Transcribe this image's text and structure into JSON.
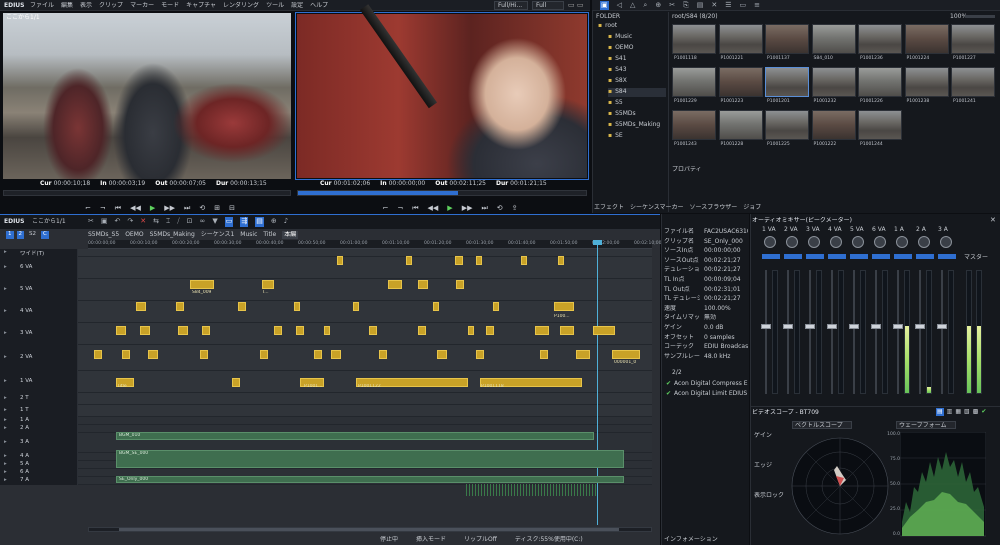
{
  "app": {
    "logo": "EDIUS"
  },
  "menubar": {
    "items": [
      "ファイル",
      "編集",
      "表示",
      "クリップ",
      "マーカー",
      "モード",
      "キャプチャ",
      "レンダリング",
      "ツール",
      "設定",
      "ヘルプ"
    ],
    "quality1": "Full/Hi...",
    "quality2": "Full"
  },
  "player": {
    "title": "ここから1/1",
    "cur": "00:00:10;18",
    "in": "00:00:03;19",
    "out": "00:00:07;05",
    "dur": "00:00:13;15"
  },
  "recorder": {
    "cur": "00:01:02;06",
    "in": "00:00:00;00",
    "out": "00:02:11;25",
    "dur": "00:01:21;15"
  },
  "folder": {
    "header": "FOLDER",
    "items": [
      "root",
      "Music",
      "OEMO",
      "S41",
      "S43",
      "S8X",
      "S84",
      "S5",
      "S5MDs",
      "S5MDs_Making",
      "SE"
    ]
  },
  "bin": {
    "path": "root/S84 (8/20)",
    "clips": [
      "P1001118",
      "P1001221",
      "P1001137",
      "S84_010",
      "P1001236",
      "P1001224",
      "P1001227",
      "P1001229",
      "P1001223",
      "P1001201",
      "P1001232",
      "P1001226",
      "P1001238",
      "P1001241",
      "P1001243",
      "P1001228",
      "P1001225",
      "P1001222",
      "P1001244"
    ],
    "tabs": [
      "エフェクト",
      "シーケンスマーカー",
      "ソースブラウザー",
      "ジョブ"
    ],
    "prop": "プロパティ",
    "zoom": "100%"
  },
  "timeline": {
    "title": "ここから1/1",
    "seqtabs": [
      "S5MDs_S5",
      "OEMO",
      "S5MDs_Making",
      "シーケンス1",
      "Music",
      "Title",
      "本編"
    ],
    "ruler": [
      "00:00:00;00",
      "00:00:10;00",
      "00:00:20;00",
      "00:00:30;00",
      "00:00:40;00",
      "00:00:50;00",
      "00:01:00;00",
      "00:01:10;00",
      "00:01:20;00",
      "00:01:30;00",
      "00:01:40;00",
      "00:01:50;00",
      "00:02:00;00",
      "00:02:10;00"
    ],
    "tracks": [
      "ワイド(T)",
      "6 VA",
      "5 VA",
      "4 VA",
      "3 VA",
      "2 VA",
      "1 VA",
      "2 T",
      "1 T",
      "1 A",
      "2 A",
      "3 A",
      "4 A",
      "5 A",
      "6 A",
      "7 A"
    ],
    "clipLabels": [
      "S84_009",
      "P...",
      "T...",
      "P1001...",
      "P1001122",
      "P1001118",
      "P1001122",
      "P1001118",
      "Title",
      "BGM_010",
      "BGM_SE_000",
      "SE_Only_000",
      "P100...",
      "000001_0"
    ],
    "status": [
      "停止中",
      "挿入モード",
      "リップルOff",
      "ディスク:55%使用中(C:)"
    ]
  },
  "info": {
    "rows": [
      [
        "ファイル名",
        "FAC2USAC6310..."
      ],
      [
        "クリップ名",
        "SE_Only_000"
      ],
      [
        "ソースIn点",
        "00:00:00;00"
      ],
      [
        "ソースOut点",
        "00:02:21;27"
      ],
      [
        "デュレーション",
        "00:02:21;27"
      ],
      [
        "TL In点",
        "00:00:09;04"
      ],
      [
        "TL Out点",
        "00:02:31;01"
      ],
      [
        "TL デュレーション",
        "00:02:21;27"
      ],
      [
        "速度",
        "100.00%"
      ],
      [
        "タイムリマップ",
        "無効"
      ],
      [
        "ゲイン",
        "0.0 dB"
      ],
      [
        "オフセット",
        "0 samples"
      ],
      [
        "コーデック",
        "EDIU Broadcast ..."
      ],
      [
        "サンプルレート",
        "48.0 kHz"
      ]
    ],
    "pages": "2/2",
    "filters": [
      "Acon Digital Compress EDI...",
      "Acon Digital Limit EDIUS E..."
    ],
    "tab": "インフォメーション"
  },
  "mixer": {
    "title": "オーディオミキサー(ピークメーター)",
    "channels": [
      "1 VA",
      "2 VA",
      "3 VA",
      "4 VA",
      "5 VA",
      "6 VA",
      "1 A",
      "2 A",
      "3 A"
    ],
    "master": "マスター",
    "levels": [
      0,
      0,
      0,
      0,
      0,
      0,
      0.55,
      0.05,
      0
    ],
    "masterLevels": [
      0.55,
      0.55
    ]
  },
  "scope": {
    "title": "ビデオスコープ - BT709",
    "mode1": "ベクトルスコープ",
    "mode2": "ウェーブフォーム",
    "labels": [
      "ゲイン",
      "エッジ",
      "表示ロック"
    ],
    "scale": [
      "100.0",
      "75.0",
      "50.0",
      "25.0",
      "0.0"
    ]
  },
  "colors": {
    "accent": "#2f6fd1",
    "clip": "#c9a227",
    "audio": "#3f6e4f",
    "meter": "#7ed36a"
  }
}
